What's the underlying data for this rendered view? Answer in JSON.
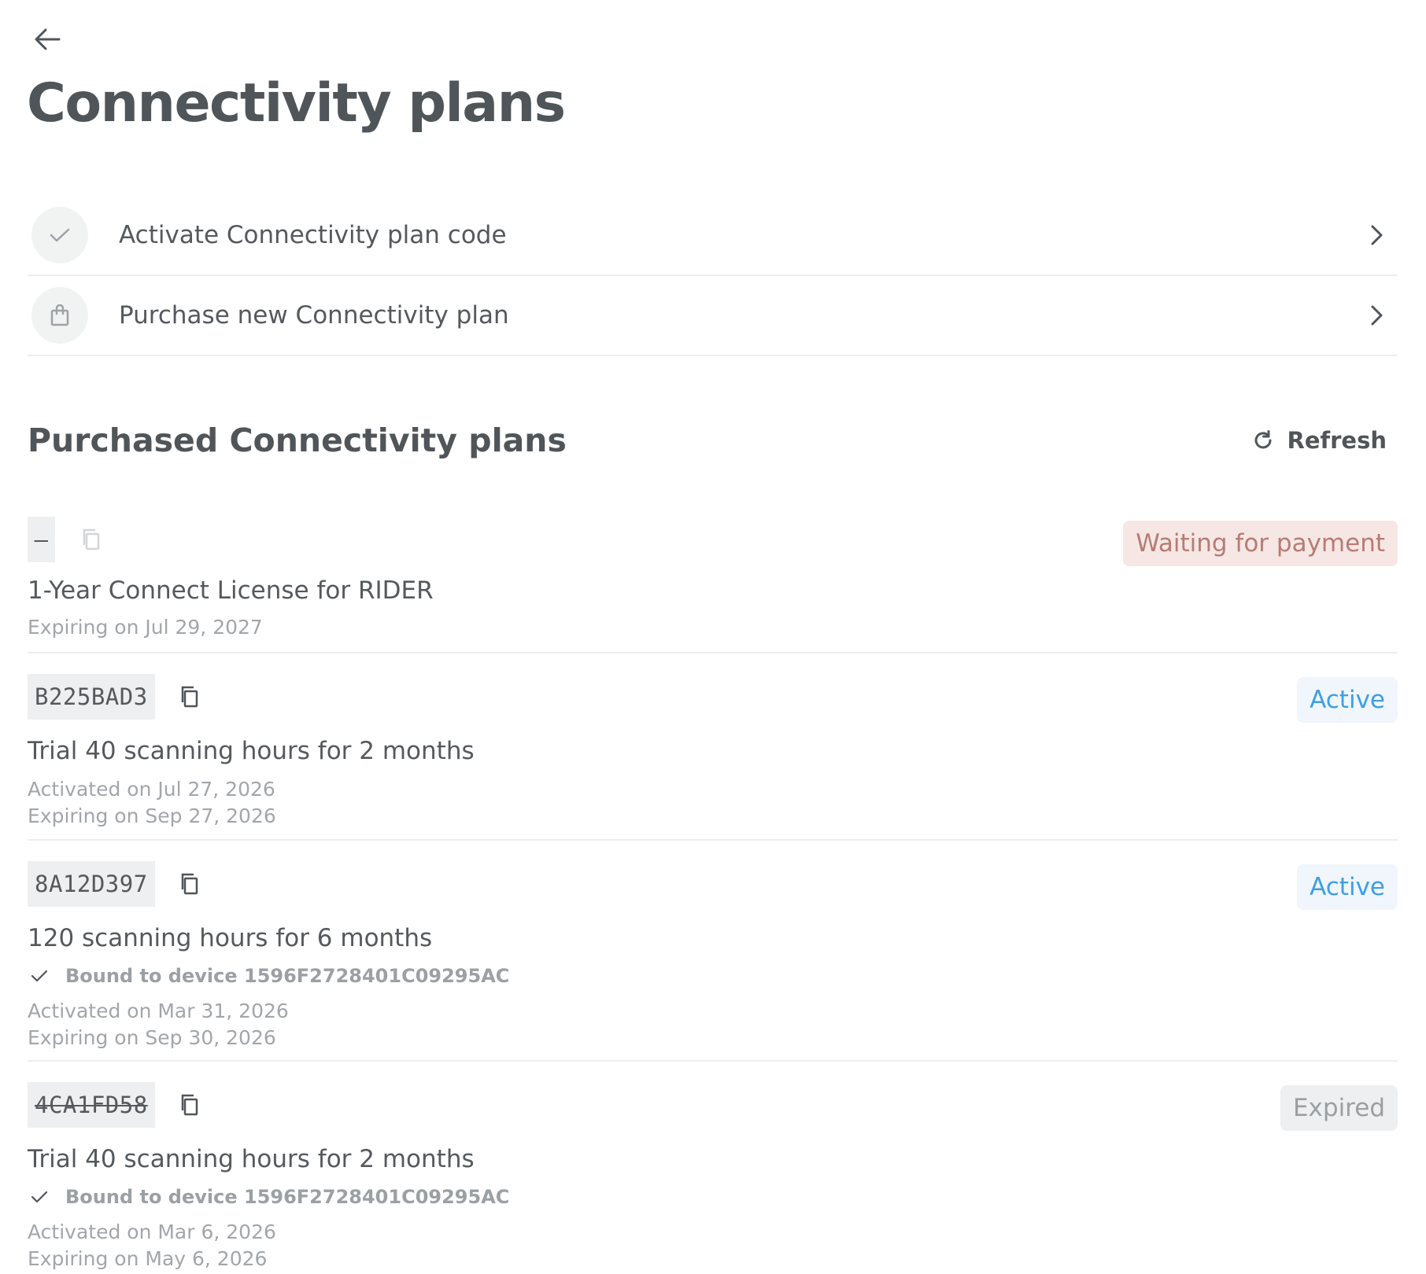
{
  "header": {
    "title": "Connectivity plans"
  },
  "actions": [
    {
      "label": "Activate Connectivity plan code",
      "icon": "check-icon"
    },
    {
      "label": "Purchase new Connectivity plan",
      "icon": "shopping-bag-icon"
    }
  ],
  "purchased": {
    "title": "Purchased Connectivity plans",
    "refresh_label": "Refresh",
    "plans": [
      {
        "code": "–",
        "status": "Waiting for payment",
        "name": "1-Year Connect License for RIDER",
        "expiring": "Expiring on Jul 29, 2027"
      },
      {
        "code": "B225BAD3",
        "status": "Active",
        "name": "Trial 40 scanning hours for 2 months",
        "activated": "Activated on Jul 27, 2026",
        "expiring": "Expiring on Sep 27, 2026"
      },
      {
        "code": "8A12D397",
        "status": "Active",
        "name": "120 scanning hours for 6 months",
        "bound": "Bound to device 1596F2728401C09295AC",
        "activated": "Activated on Mar 31, 2026",
        "expiring": "Expiring on Sep 30, 2026"
      },
      {
        "code": "4CA1FD58",
        "status": "Expired",
        "name": "Trial 40 scanning hours for 2 months",
        "bound": "Bound to device 1596F2728401C09295AC",
        "activated": "Activated on Mar 6, 2026",
        "expiring": "Expiring on May 6, 2026"
      }
    ]
  },
  "colors": {
    "active": "#3f9ee5",
    "waiting": "#b77c74",
    "expired": "#9a9fa3"
  }
}
